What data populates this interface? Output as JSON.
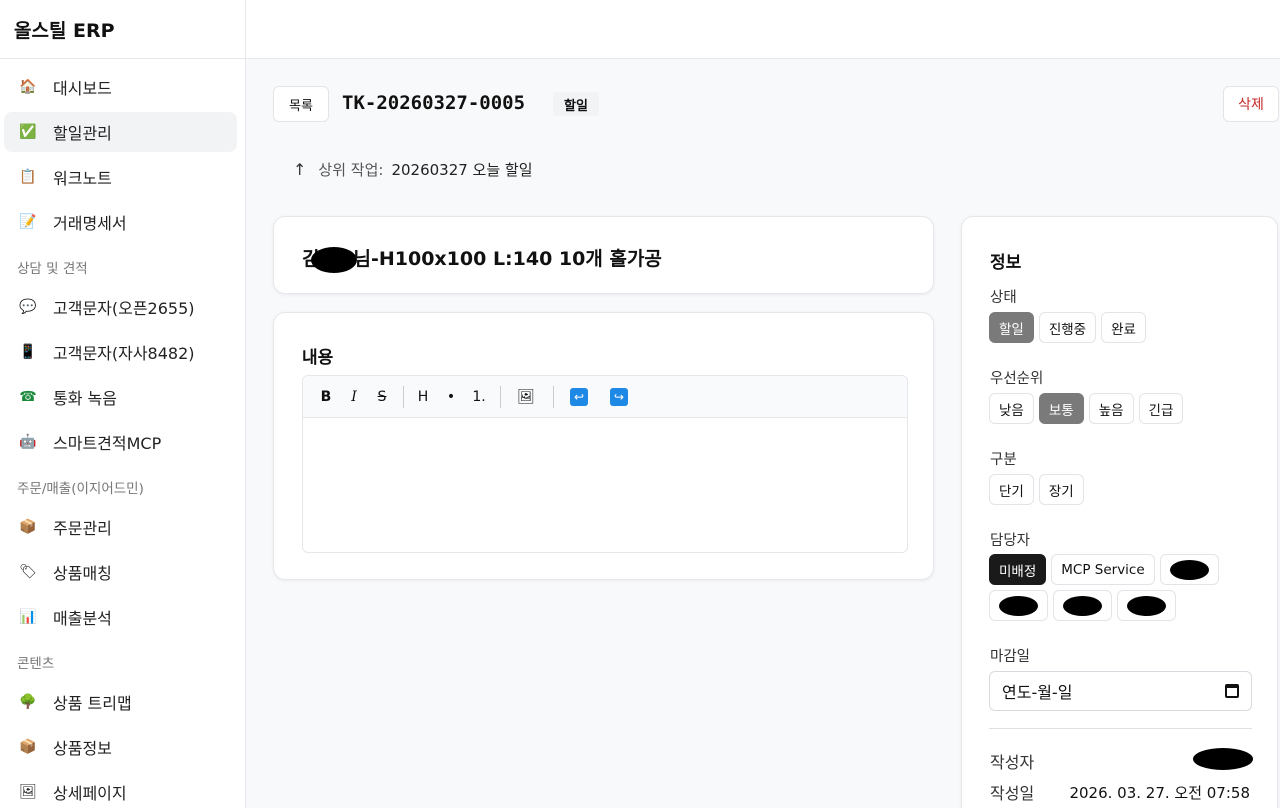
{
  "app": {
    "brand": "올스틸 ERP"
  },
  "sidebar": {
    "items": [
      {
        "label": "대시보드",
        "icon": "🏠"
      },
      {
        "label": "할일관리",
        "icon": "✅"
      },
      {
        "label": "워크노트",
        "icon": "📋"
      },
      {
        "label": "거래명세서",
        "icon": "📝"
      }
    ],
    "sections": [
      {
        "label": "상담 및 견적",
        "items": [
          {
            "label": "고객문자(오픈2655)",
            "icon": "💬"
          },
          {
            "label": "고객문자(자사8482)",
            "icon": "📱"
          },
          {
            "label": "통화 녹음",
            "icon": "☎"
          },
          {
            "label": "스마트견적MCP",
            "icon": "🤖"
          }
        ]
      },
      {
        "label": "주문/매출(이지어드민)",
        "items": [
          {
            "label": "주문관리",
            "icon": "📦"
          },
          {
            "label": "상품매칭",
            "icon": "🏷"
          },
          {
            "label": "매출분석",
            "icon": "📊"
          }
        ]
      },
      {
        "label": "콘텐츠",
        "items": [
          {
            "label": "상품 트리맵",
            "icon": "🌳"
          },
          {
            "label": "상품정보",
            "icon": "📦"
          },
          {
            "label": "상세페이지",
            "icon": "🖼"
          }
        ]
      }
    ]
  },
  "header": {
    "list_button": "목록",
    "ticket_id": "TK-20260327-0005",
    "type_badge": "할일",
    "delete_button": "삭제"
  },
  "parent": {
    "arrow": "↑",
    "label": "상위 작업:",
    "value": "20260327 오늘 할일"
  },
  "task": {
    "title_prefix": "김",
    "title_suffix": "님-H100x100 L:140 10개 홀가공"
  },
  "content": {
    "heading": "내용",
    "toolbar": [
      "B",
      "I",
      "S",
      "H",
      "•",
      "1.",
      "🖼",
      "↩",
      "↪"
    ]
  },
  "info": {
    "title": "정보",
    "status": {
      "label": "상태",
      "options": [
        "할일",
        "진행중",
        "완료"
      ],
      "selected": "할일"
    },
    "priority": {
      "label": "우선순위",
      "options": [
        "낮음",
        "보통",
        "높음",
        "긴급"
      ],
      "selected": "보통"
    },
    "category": {
      "label": "구분",
      "options": [
        "단기",
        "장기"
      ]
    },
    "assignee": {
      "label": "담당자",
      "options": [
        "미배정",
        "MCP Service"
      ],
      "selected": "미배정"
    },
    "due": {
      "label": "마감일",
      "placeholder": "연도-월-일"
    },
    "author_label": "작성자",
    "created_label": "작성일",
    "created_value": "2026. 03. 27. 오전 07:58"
  }
}
